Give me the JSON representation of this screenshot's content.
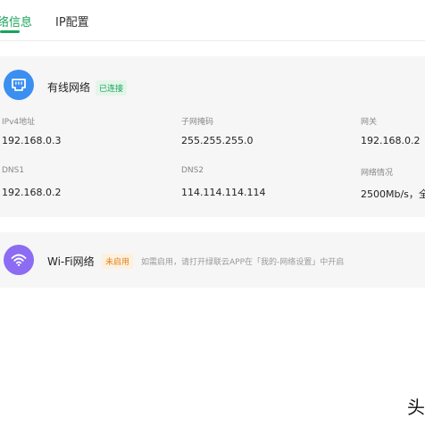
{
  "tabs": [
    {
      "label": "络信息",
      "active": true
    },
    {
      "label": "IP配置",
      "active": false
    }
  ],
  "wired": {
    "title": "有线网络",
    "status": "已连接",
    "icon": "ethernet-port-icon",
    "fields": {
      "ipv4_label": "IPv4地址",
      "ipv4_value": "192.168.0.3",
      "mask_label": "子网掩码",
      "mask_value": "255.255.255.0",
      "gateway_label": "网关",
      "gateway_value": "192.168.0.2",
      "dns1_label": "DNS1",
      "dns1_value": "192.168.0.2",
      "dns2_label": "DNS2",
      "dns2_value": "114.114.114.114",
      "speed_label": "网络情况",
      "speed_value": "2500Mb/s，全"
    }
  },
  "wifi": {
    "title": "Wi-Fi网络",
    "status": "未启用",
    "hint": "如需启用，请打开绿联云APP在「我的-网络设置」中开启",
    "icon": "wifi-icon"
  },
  "watermark": "头",
  "colors": {
    "accent": "#1aa35a",
    "wired_icon_bg": "#3b8ff0",
    "wifi_icon_bg": "#8b6cf2",
    "warning": "#e0821a"
  }
}
